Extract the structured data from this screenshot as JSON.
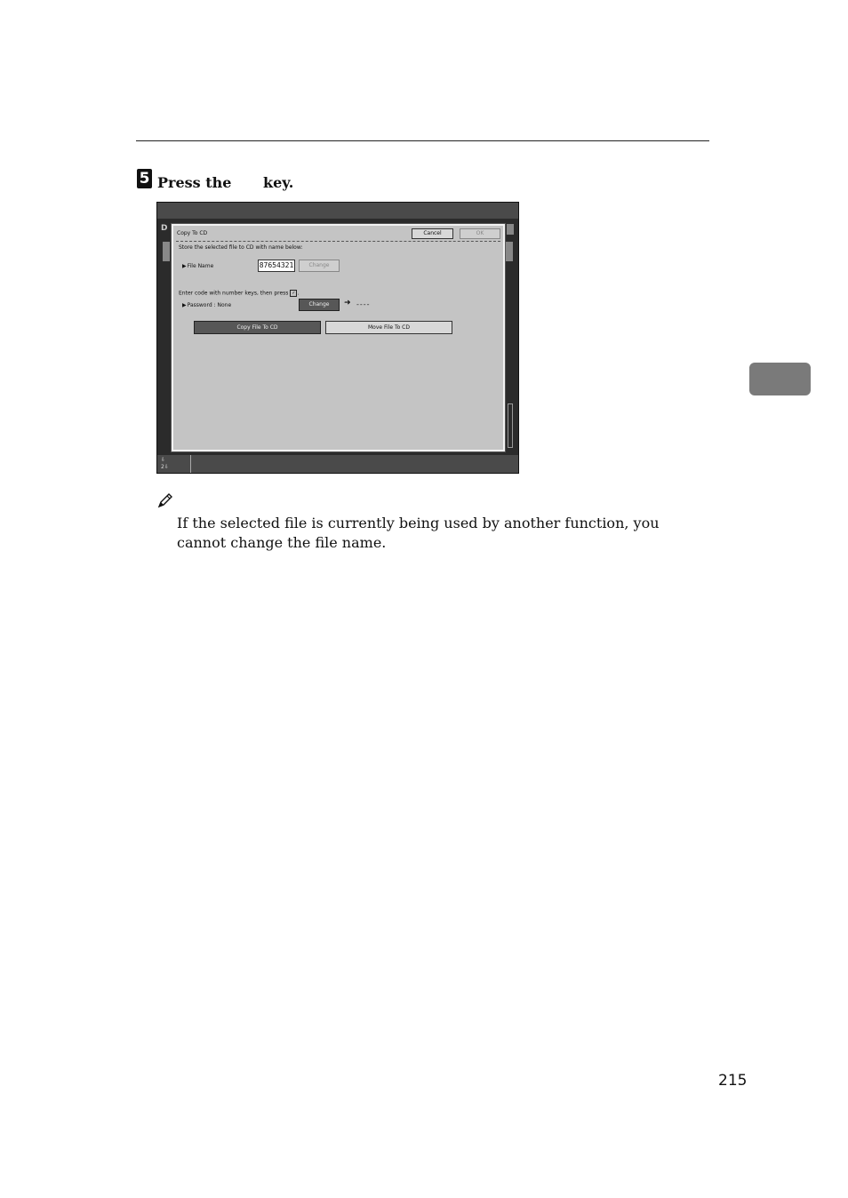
{
  "step": {
    "number": "5",
    "press": "Press the",
    "key": "key."
  },
  "screen": {
    "dialog_title": "Copy To CD",
    "cancel_label": "Cancel",
    "ok_label": "OK",
    "instruction": "Store the selected file to CD with name below:",
    "file_name_label": "File Name",
    "file_name_value": "87654321",
    "change_label": "Change",
    "enter_code_text": "Enter code with number keys, then press",
    "ok_glyph": "#",
    "password_label": "Password : None",
    "password_change_label": "Change",
    "password_mask": "----",
    "copy_file_label": "Copy File To CD",
    "move_file_label": "Move File To CD",
    "bottom_status_1": "⇩",
    "bottom_status_2": "2⇩"
  },
  "note": {
    "text": "If the selected file is currently being used by another function, you cannot change the file name."
  },
  "page_number": "215"
}
